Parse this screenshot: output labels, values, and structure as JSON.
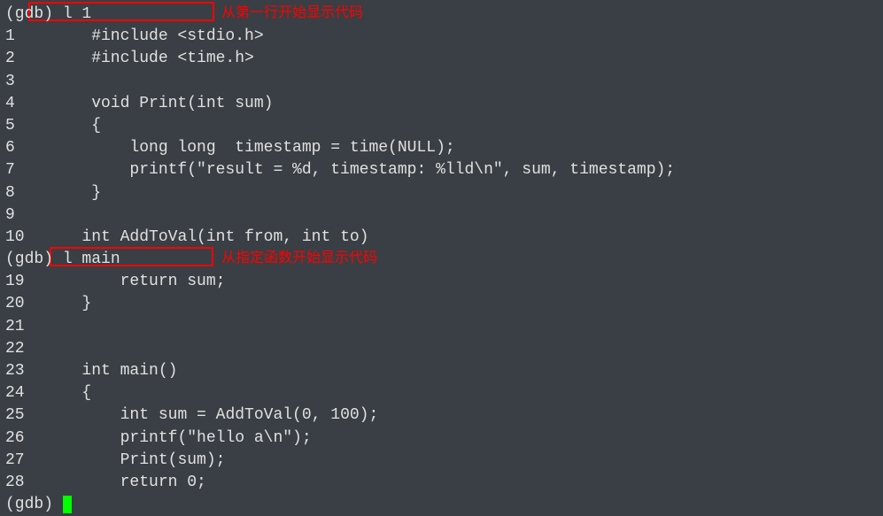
{
  "session": {
    "prompt": "(gdb)",
    "cmd1": "l 1",
    "cmd2": "l main",
    "annotation1": "从第一行开始显示代码",
    "annotation2": "从指定函数开始显示代码"
  },
  "listing1": [
    {
      "n": "1",
      "code": "       #include <stdio.h>"
    },
    {
      "n": "2",
      "code": "       #include <time.h>"
    },
    {
      "n": "3",
      "code": ""
    },
    {
      "n": "4",
      "code": "       void Print(int sum)"
    },
    {
      "n": "5",
      "code": "       {"
    },
    {
      "n": "6",
      "code": "           long long  timestamp = time(NULL);"
    },
    {
      "n": "7",
      "code": "           printf(\"result = %d, timestamp: %lld\\n\", sum, timestamp);"
    },
    {
      "n": "8",
      "code": "       }"
    },
    {
      "n": "9",
      "code": ""
    },
    {
      "n": "10",
      "code": "      int AddToVal(int from, int to)"
    }
  ],
  "listing2": [
    {
      "n": "19",
      "code": "          return sum;"
    },
    {
      "n": "20",
      "code": "      }"
    },
    {
      "n": "21",
      "code": ""
    },
    {
      "n": "22",
      "code": ""
    },
    {
      "n": "23",
      "code": "      int main()"
    },
    {
      "n": "24",
      "code": "      {"
    },
    {
      "n": "25",
      "code": "          int sum = AddToVal(0, 100);"
    },
    {
      "n": "26",
      "code": "          printf(\"hello a\\n\");"
    },
    {
      "n": "27",
      "code": "          Print(sum);"
    },
    {
      "n": "28",
      "code": "          return 0;"
    }
  ]
}
